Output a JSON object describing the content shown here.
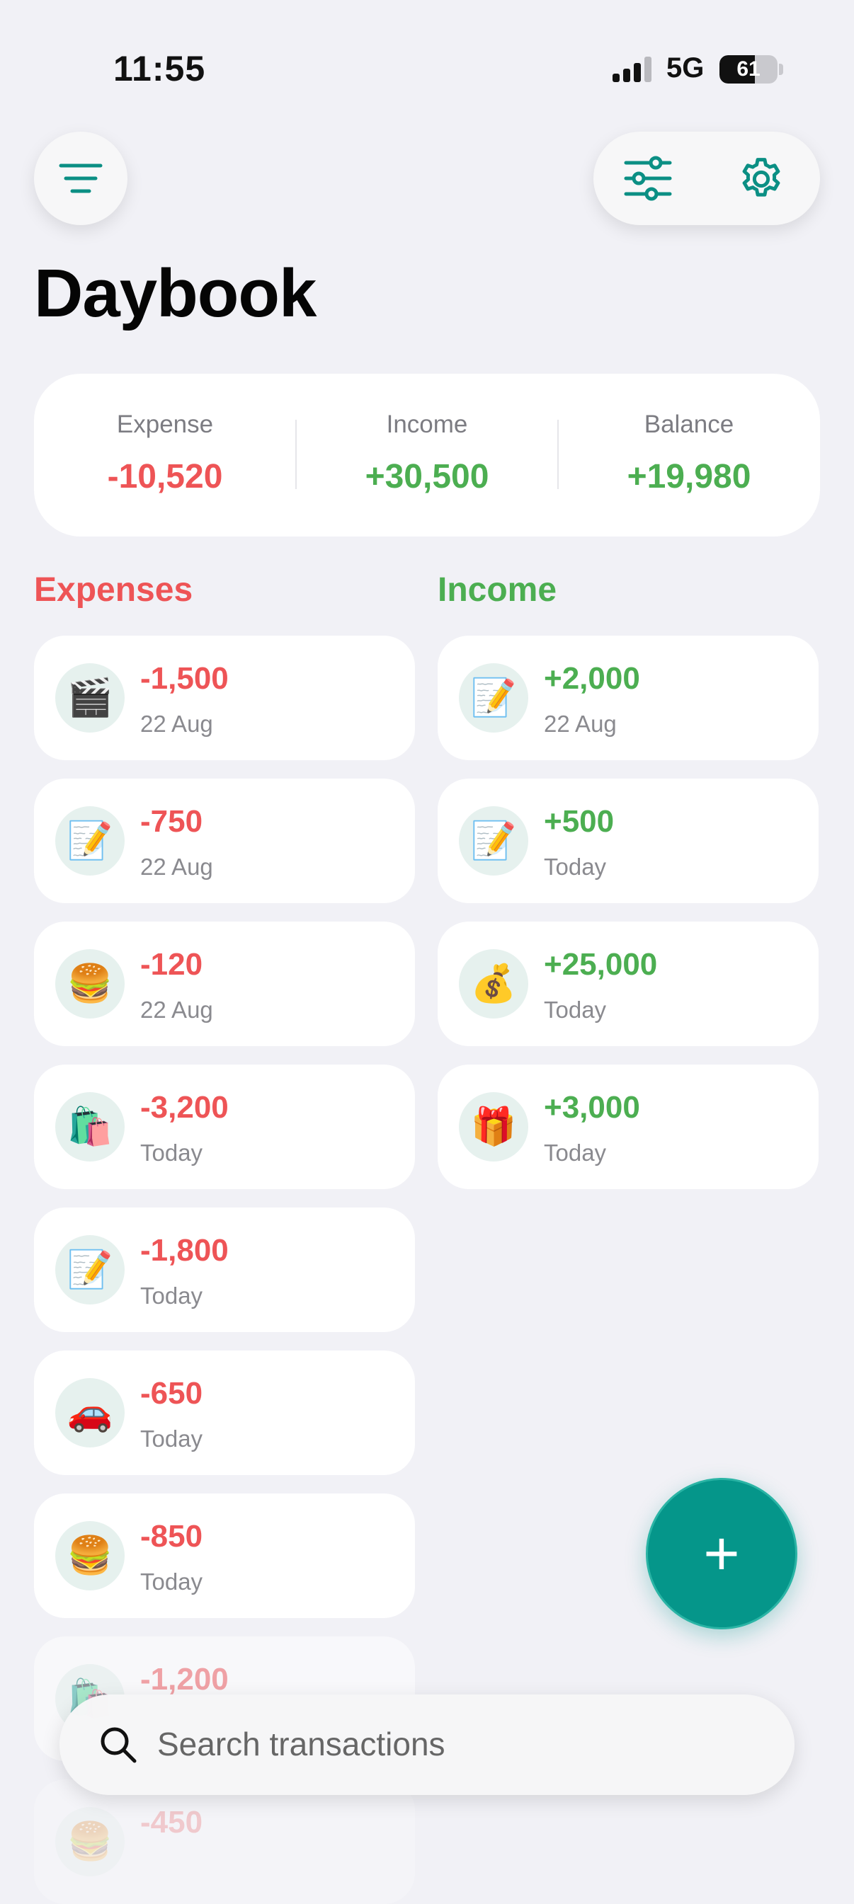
{
  "status_bar": {
    "time": "11:55",
    "network": "5G",
    "battery": "61",
    "battery_level": 0.61
  },
  "header": {
    "title": "Daybook",
    "menu_icon": "menu-icon",
    "filter_icon": "sliders-icon",
    "settings_icon": "gear-icon"
  },
  "summary": {
    "expense_label": "Expense",
    "expense_value": "-10,520",
    "income_label": "Income",
    "income_value": "+30,500",
    "balance_label": "Balance",
    "balance_value": "+19,980"
  },
  "expenses": {
    "title": "Expenses",
    "items": [
      {
        "emoji": "🎬",
        "amount": "-1,500",
        "date": "22 Aug"
      },
      {
        "emoji": "📝",
        "amount": "-750",
        "date": "22 Aug"
      },
      {
        "emoji": "🍔",
        "amount": "-120",
        "date": "22 Aug"
      },
      {
        "emoji": "🛍️",
        "amount": "-3,200",
        "date": "Today"
      },
      {
        "emoji": "📝",
        "amount": "-1,800",
        "date": "Today"
      },
      {
        "emoji": "🚗",
        "amount": "-650",
        "date": "Today"
      },
      {
        "emoji": "🍔",
        "amount": "-850",
        "date": "Today"
      },
      {
        "emoji": "🛍️",
        "amount": "-1,200",
        "date": ""
      },
      {
        "emoji": "🍔",
        "amount": "-450",
        "date": ""
      }
    ]
  },
  "income": {
    "title": "Income",
    "items": [
      {
        "emoji": "📝",
        "amount": "+2,000",
        "date": "22 Aug"
      },
      {
        "emoji": "📝",
        "amount": "+500",
        "date": "Today"
      },
      {
        "emoji": "💰",
        "amount": "+25,000",
        "date": "Today"
      },
      {
        "emoji": "🎁",
        "amount": "+3,000",
        "date": "Today"
      }
    ]
  },
  "fab": {
    "label": "+",
    "icon": "plus-icon"
  },
  "search": {
    "placeholder": "Search transactions",
    "value": ""
  },
  "colors": {
    "accent": "#05968a",
    "expense": "#ee5456",
    "income": "#4cae51",
    "background": "#f1f1f6"
  }
}
